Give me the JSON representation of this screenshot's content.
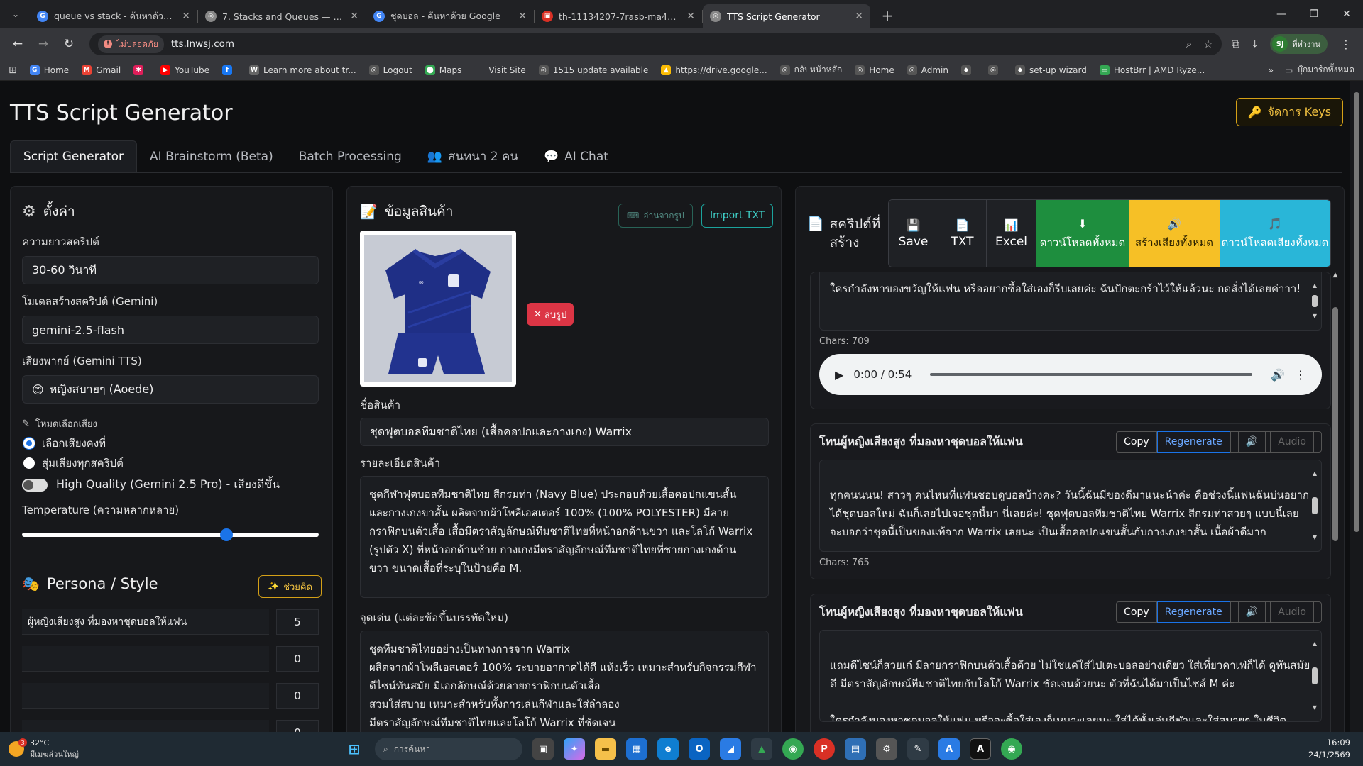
{
  "browser": {
    "tabs": [
      {
        "title": "queue vs stack - ค้นหาด้วย Google",
        "icon": "google-icon",
        "color": "#4285f4",
        "glyph": "G"
      },
      {
        "title": "7. Stacks and Queues — Data S",
        "icon": "globe-icon",
        "color": "#888888",
        "glyph": "◎"
      },
      {
        "title": "ชุดบอล - ค้นหาด้วย Google",
        "icon": "google-icon",
        "color": "#4285f4",
        "glyph": "G"
      },
      {
        "title": "th-11134207-7rasb-ma4xb2jy3",
        "icon": "image-icon",
        "color": "#d93025",
        "glyph": "▣"
      },
      {
        "title": "TTS Script Generator",
        "icon": "globe-icon",
        "color": "#888888",
        "glyph": "◎"
      }
    ],
    "insecure_label": "ไม่ปลอดภัย",
    "url": "tts.lnwsj.com",
    "profile_initials": "SJ",
    "profile_label": "ที่ทำงาน",
    "bookmarks": [
      {
        "label": "Home",
        "icon": "google-icon",
        "color": "#4285f4",
        "glyph": "G"
      },
      {
        "label": "Gmail",
        "icon": "gmail-icon",
        "color": "#ea4335",
        "glyph": "M"
      },
      {
        "label": "",
        "icon": "slack-icon",
        "color": "#e01e5a",
        "glyph": "✱"
      },
      {
        "label": "YouTube",
        "icon": "youtube-icon",
        "color": "#ff0000",
        "glyph": "▶"
      },
      {
        "label": "",
        "icon": "facebook-icon",
        "color": "#1877f2",
        "glyph": "f"
      },
      {
        "label": "Learn more about tr...",
        "icon": "wordpress-icon",
        "color": "#666666",
        "glyph": "W"
      },
      {
        "label": "Logout",
        "icon": "globe-icon",
        "color": "#555555",
        "glyph": "◎"
      },
      {
        "label": "Maps",
        "icon": "maps-icon",
        "color": "#34a853",
        "glyph": "⬤"
      },
      {
        "label": "Visit Site",
        "icon": "blank-icon",
        "color": "#35363a",
        "glyph": ""
      },
      {
        "label": "1515 update available",
        "icon": "globe-icon",
        "color": "#555555",
        "glyph": "◎"
      },
      {
        "label": "https://drive.google...",
        "icon": "drive-icon",
        "color": "#fbbc04",
        "glyph": "▲"
      },
      {
        "label": "กลับหน้าหลัก",
        "icon": "globe-icon",
        "color": "#555555",
        "glyph": "◎"
      },
      {
        "label": "Home",
        "icon": "globe-icon",
        "color": "#555555",
        "glyph": "◎"
      },
      {
        "label": "Admin",
        "icon": "globe-icon",
        "color": "#555555",
        "glyph": "◎"
      },
      {
        "label": "",
        "icon": "diamond-icon",
        "color": "#555555",
        "glyph": "◆"
      },
      {
        "label": "",
        "icon": "globe-icon",
        "color": "#555555",
        "glyph": "◎"
      },
      {
        "label": "set-up wizard",
        "icon": "diamond-icon",
        "color": "#555555",
        "glyph": "◆"
      },
      {
        "label": "HostBrr | AMD Ryze...",
        "icon": "monitor-icon",
        "color": "#34a853",
        "glyph": "▭"
      }
    ],
    "bookmarks_folder": "บุ๊กมาร์กทั้งหมด"
  },
  "app": {
    "title": "TTS Script Generator",
    "keys_button": "จัดการ Keys",
    "tabs": [
      {
        "label": "Script Generator",
        "active": true,
        "icon": ""
      },
      {
        "label": "AI Brainstorm (Beta)",
        "active": false,
        "icon": ""
      },
      {
        "label": "Batch Processing",
        "active": false,
        "icon": ""
      },
      {
        "label": "สนทนา 2 คน",
        "active": false,
        "icon": "👥"
      },
      {
        "label": "AI Chat",
        "active": false,
        "icon": "💬"
      }
    ]
  },
  "settings": {
    "heading": "ตั้งค่า",
    "length_label": "ความยาวสคริปต์",
    "length_value": "30-60 วินาที",
    "model_label": "โมเดลสร้างสคริปต์ (Gemini)",
    "model_value": "gemini-2.5-flash",
    "voice_label": "เสียงพากย์ (Gemini TTS)",
    "voice_value": "หญิงสบายๆ (Aoede)",
    "voice_mode_label": "โหมดเลือกเสียง",
    "voice_mode_options": [
      "เลือกเสียงคงที่",
      "สุ่มเสียงทุกสคริปต์"
    ],
    "hq_label": "High Quality (Gemini 2.5 Pro) - เสียงดีขึ้น",
    "temperature_label": "Temperature (ความหลากหลาย)",
    "temperature_value": 0.69,
    "persona_heading": "Persona / Style",
    "persona_help_button": "ช่วยคิด",
    "personas": [
      {
        "name": "ผู้หญิงเสียงสูง ที่มองหาชุดบอลให้แฟน",
        "count": "5"
      },
      {
        "name": "",
        "count": "0"
      },
      {
        "name": "",
        "count": "0"
      },
      {
        "name": "",
        "count": "0"
      }
    ]
  },
  "product": {
    "heading": "ข้อมูลสินค้า",
    "read_image_button": "อ่านจากรูป",
    "import_button": "Import TXT",
    "remove_image_button": "ลบรูป",
    "name_label": "ชื่อสินค้า",
    "name_value": "ชุดฟุตบอลทีมชาติไทย (เสื้อคอปกและกางเกง) Warrix",
    "detail_label": "รายละเอียดสินค้า",
    "detail_lines": [
      "ชุดกีฬาฟุตบอลทีมชาติไทย สีกรมท่า (Navy Blue) ประกอบด้วยเสื้อคอปกแขนสั้น",
      "และกางเกงขาสั้น ผลิตจากผ้าโพลีเอสเตอร์ 100% (100% POLYESTER) มีลาย",
      "กราฟิกบนตัวเสื้อ เสื้อมีตราสัญลักษณ์ทีมชาติไทยที่หน้าอกด้านขวา และโลโก้ Warrix",
      "(รูปตัว X) ที่หน้าอกด้านซ้าย กางเกงมีตราสัญลักษณ์ทีมชาติไทยที่ชายกางเกงด้าน",
      "ขวา ขนาดเสื้อที่ระบุในป้ายคือ M."
    ],
    "highlight_label": "จุดเด่น (แต่ละข้อขึ้นบรรทัดใหม่)",
    "highlight_lines": [
      "ชุดทีมชาติไทยอย่างเป็นทางการจาก Warrix",
      "ผลิตจากผ้าโพลีเอสเตอร์ 100% ระบายอากาศได้ดี แห้งเร็ว เหมาะสำหรับกิจกรรมกีฬา",
      "ดีไซน์ทันสมัย มีเอกลักษณ์ด้วยลายกราฟิกบนตัวเสื้อ",
      "สวมใส่สบาย เหมาะสำหรับทั้งการเล่นกีฬาและใส่ลำลอง",
      "มีตราสัญลักษณ์ทีมชาติไทยและโลโก้ Warrix ที่ชัดเจน"
    ]
  },
  "scripts": {
    "heading": "สคริปต์ที่สร้าง",
    "tools": [
      {
        "label": "Save",
        "icon": "save-icon",
        "bg": "#1f2125"
      },
      {
        "label": "TXT",
        "icon": "file-txt-icon",
        "bg": "#1f2125"
      },
      {
        "label": "Excel",
        "icon": "spreadsheet-icon",
        "bg": "#1f2125"
      },
      {
        "label": "ดาวน์โหลดทั้งหมด",
        "icon": "download-icon",
        "bg": "#1e8e3e"
      },
      {
        "label": "สร้างเสียงทั้งหมด",
        "icon": "speaker-icon",
        "bg": "#f6c026"
      },
      {
        "label": "ดาวน์โหลดเสียงทั้งหมด",
        "icon": "music-icon",
        "bg": "#29b6d8"
      }
    ],
    "first": {
      "text": "ใครกำลังหาของขวัญให้แฟน หรืออยากซื้อใส่เองก็รีบเลยค่ะ ฉันปักตะกร้าไว้ให้แล้วนะ กดสั่งได้เลยค่าาา!",
      "chars": "Chars: 709",
      "time": "0:00 / 0:54"
    },
    "items": [
      {
        "title": "โทนผู้หญิงเสียงสูง ที่มองหาชุดบอลให้แฟน",
        "text": "ทุกคนนนน! สาวๆ คนไหนที่แฟนชอบดูบอลบ้างคะ? วันนี้ฉันมีของดีมาแนะนำค่ะ คือช่วงนี้แฟนฉันบ่นอยากได้ชุดบอลใหม่ ฉันก็เลยไปเจอชุดนี้มา นี่เลยค่ะ! ชุดฟุตบอลทีมชาติไทย Warrix สีกรมท่าสวยๆ แบบนี้เลย จะบอกว่าชุดนี้เป็นของแท้จาก Warrix เลยนะ เป็นเสื้อคอปกแขนสั้นกับกางเกงขาสั้น เนื้อผ้าดีมาก",
        "chars": "Chars: 765"
      },
      {
        "title": "โทนผู้หญิงเสียงสูง ที่มองหาชุดบอลให้แฟน",
        "text": "แถมดีไซน์ก็สวยเก๋ มีลายกราฟิกบนตัวเสื้อด้วย ไม่ใช่แค่ใส่ไปเตะบอลอย่างเดียว ใส่เที่ยวคาเฟ่ก็ได้ ดูทันสมัยดี มีตราสัญลักษณ์ทีมชาติไทยกับโลโก้ Warrix ชัดเจนด้วยนะ ตัวที่ฉันได้มาเป็นไซส์ M ค่ะ\n\nใครกำลังมองหาชุดบอลให้แฟน หรือจะซื้อใส่เองก็เหมาะเลยนะ ใส่ได้ทั้งเล่นกีฬาและใส่สบายๆ ในชีวิตประจำวัน ใครสนใจรีบกดตะกร้าเลยน้าาา ของมันต้องมีจริงๆ ค่ะ!",
        "chars": ""
      }
    ],
    "copy_label": "Copy",
    "regen_label": "Regenerate",
    "audio_label": "Audio"
  },
  "taskbar": {
    "temp": "32°C",
    "weather": "มีเมฆส่วนใหญ่",
    "badge": "3",
    "search_placeholder": "การค้นหา",
    "time": "16:09",
    "date": "24/1/2569"
  }
}
